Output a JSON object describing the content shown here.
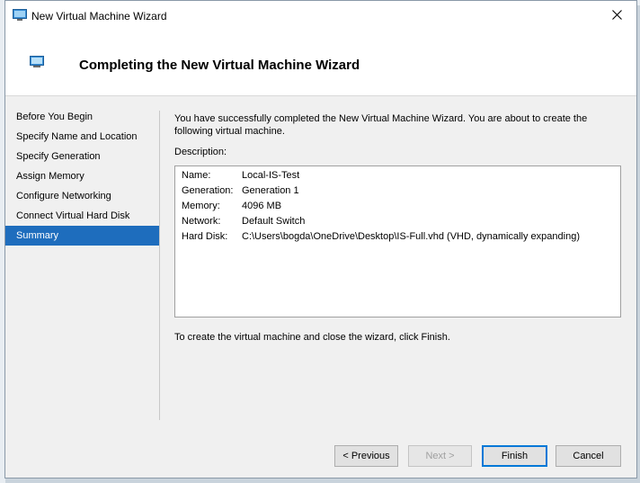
{
  "window": {
    "title": "New Virtual Machine Wizard"
  },
  "header": {
    "title": "Completing the New Virtual Machine Wizard"
  },
  "nav": {
    "items": [
      {
        "label": "Before You Begin"
      },
      {
        "label": "Specify Name and Location"
      },
      {
        "label": "Specify Generation"
      },
      {
        "label": "Assign Memory"
      },
      {
        "label": "Configure Networking"
      },
      {
        "label": "Connect Virtual Hard Disk"
      },
      {
        "label": "Summary",
        "selected": true
      }
    ]
  },
  "content": {
    "intro_line1": "You have successfully completed the New Virtual Machine Wizard. You are about to create the",
    "intro_line2": "following virtual machine.",
    "description_label": "Description:",
    "details": [
      {
        "key": "Name:",
        "value": "Local-IS-Test"
      },
      {
        "key": "Generation:",
        "value": "Generation 1"
      },
      {
        "key": "Memory:",
        "value": "4096 MB"
      },
      {
        "key": "Network:",
        "value": "Default Switch"
      },
      {
        "key": "Hard Disk:",
        "value": "C:\\Users\\bogda\\OneDrive\\Desktop\\IS-Full.vhd (VHD, dynamically expanding)"
      }
    ],
    "finish_note": "To create the virtual machine and close the wizard, click Finish."
  },
  "buttons": {
    "previous": "< Previous",
    "next": "Next >",
    "finish": "Finish",
    "cancel": "Cancel"
  },
  "colors": {
    "selection": "#1e6dbd",
    "default_button_border": "#0078d7"
  }
}
